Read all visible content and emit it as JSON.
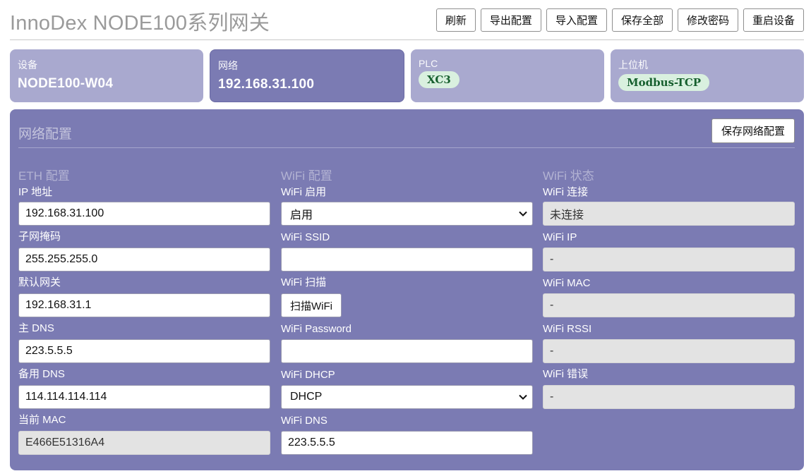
{
  "header": {
    "title": "InnoDex NODE100系列网关",
    "buttons": [
      "刷新",
      "导出配置",
      "导入配置",
      "保存全部",
      "修改密码",
      "重启设备"
    ]
  },
  "cards": {
    "device": {
      "label": "设备",
      "value": "NODE100-W04"
    },
    "network": {
      "label": "网络",
      "value": "192.168.31.100"
    },
    "plc": {
      "label": "PLC",
      "value": "XC3"
    },
    "host": {
      "label": "上位机",
      "value": "Modbus-TCP"
    }
  },
  "panel": {
    "title": "网络配置",
    "save_label": "保存网络配置",
    "eth": {
      "title": "ETH 配置",
      "fields": [
        {
          "label": "IP 地址",
          "value": "192.168.31.100"
        },
        {
          "label": "子网掩码",
          "value": "255.255.255.0"
        },
        {
          "label": "默认网关",
          "value": "192.168.31.1"
        },
        {
          "label": "主 DNS",
          "value": "223.5.5.5"
        },
        {
          "label": "备用 DNS",
          "value": "114.114.114.114"
        },
        {
          "label": "当前 MAC",
          "value": "E466E51316A4"
        }
      ]
    },
    "wifi": {
      "title": "WiFi 配置",
      "enable_label": "WiFi 启用",
      "enable_value": "启用",
      "ssid_label": "WiFi SSID",
      "ssid_value": "",
      "scan_label": "WiFi 扫描",
      "scan_button": "扫描WiFi",
      "password_label": "WiFi Password",
      "password_value": "",
      "dhcp_label": "WiFi DHCP",
      "dhcp_value": "DHCP",
      "dns_label": "WiFi DNS",
      "dns_value": "223.5.5.5"
    },
    "status": {
      "title": "WiFi 状态",
      "fields": [
        {
          "label": "WiFi 连接",
          "value": "未连接"
        },
        {
          "label": "WiFi IP",
          "value": "-"
        },
        {
          "label": "WiFi MAC",
          "value": "-"
        },
        {
          "label": "WiFi RSSI",
          "value": "-"
        },
        {
          "label": "WiFi 错误",
          "value": "-"
        }
      ]
    }
  },
  "colors": {
    "panel_bg": "#7b7bb3",
    "card_bg": "#a9a9cf",
    "pill_bg": "#d9f0df",
    "pill_text": "#165f2e"
  }
}
